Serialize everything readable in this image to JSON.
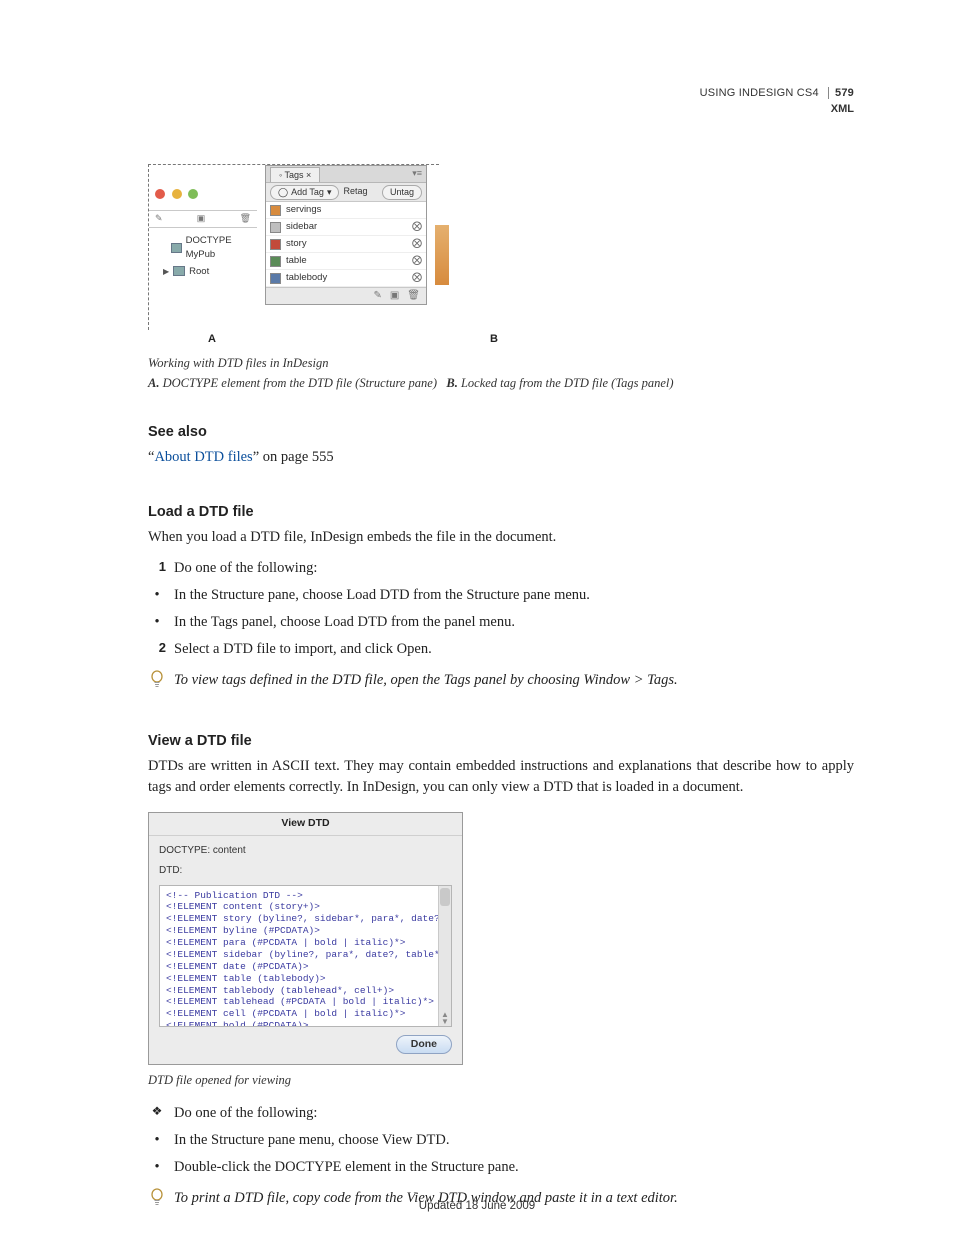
{
  "runningHead": {
    "book": "USING INDESIGN CS4",
    "page": "579",
    "section": "XML"
  },
  "figure1": {
    "tagsTabLabel": "Tags",
    "addTag": "Add Tag",
    "retag": "Retag",
    "untag": "Untag",
    "tree": {
      "doctype": "DOCTYPE MyPub",
      "root": "Root"
    },
    "tags": [
      "servings",
      "sidebar",
      "story",
      "table",
      "tablebody"
    ],
    "calloutA": "A",
    "calloutB": "B",
    "caption": "Working with DTD files in InDesign",
    "keyA_label": "A.",
    "keyA_text": "DOCTYPE element from the DTD file (Structure pane)",
    "keyB_label": "B.",
    "keyB_text": "Locked tag from the DTD file (Tags panel)"
  },
  "seeAlsoHeading": "See also",
  "seeAlso": {
    "pre": "“",
    "link": "About DTD files",
    "post": "” on page 555"
  },
  "loadHeading": "Load a DTD file",
  "loadIntro": "When you load a DTD file, InDesign embeds the file in the document.",
  "step1": "Do one of the following:",
  "loadBullets": [
    "In the Structure pane, choose Load DTD from the Structure pane menu.",
    "In the Tags panel, choose Load DTD from the panel menu."
  ],
  "step2": "Select a DTD file to import, and click Open.",
  "loadTip": "To view tags defined in the DTD file, open the Tags panel by choosing Window > Tags.",
  "viewHeading": "View a DTD file",
  "viewIntro": "DTDs are written in ASCII text. They may contain embedded instructions and explanations that describe how to apply tags and order elements correctly. In InDesign, you can only view a DTD that is loaded in a document.",
  "dialog": {
    "title": "View DTD",
    "doctypeLabel": "DOCTYPE: content",
    "dtdLabel": "DTD:",
    "lines": [
      "<!-- Publication DTD -->",
      "<!ELEMENT content (story+)>",
      "<!ELEMENT story (byline?, sidebar*, para*, date?, table*)>",
      "<!ELEMENT byline (#PCDATA)>",
      "<!ELEMENT para (#PCDATA | bold | italic)*>",
      "<!ELEMENT sidebar (byline?, para*, date?, table*)>",
      "<!ELEMENT date (#PCDATA)>",
      "<!ELEMENT table (tablebody)>",
      "<!ELEMENT tablebody (tablehead*, cell+)>",
      "<!ELEMENT tablehead (#PCDATA | bold | italic)*>",
      "<!ELEMENT cell (#PCDATA | bold | italic)*>",
      "<!ELEMENT bold (#PCDATA)>"
    ],
    "done": "Done",
    "caption": "DTD file opened for viewing"
  },
  "viewLead": "Do one of the following:",
  "viewBullets": [
    "In the Structure pane menu, choose View DTD.",
    "Double-click the DOCTYPE element in the Structure pane."
  ],
  "viewTip": "To print a DTD file, copy code from the View DTD window and paste it in a text editor.",
  "footer": "Updated 18 June 2009"
}
